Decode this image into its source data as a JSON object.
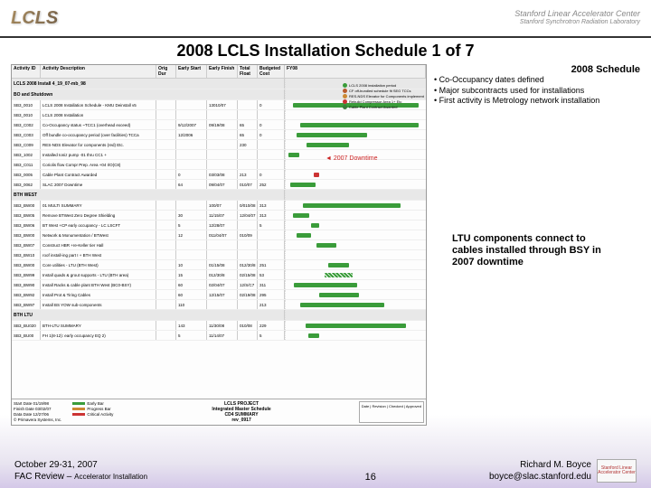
{
  "header": {
    "logo_text": "LCLS",
    "org_line1": "Stanford Linear Accelerator Center",
    "org_line2": "Stanford Synchrotron Radiation Laboratory"
  },
  "title": "2008 LCLS Installation Schedule 1 of 7",
  "chart": {
    "columns": {
      "id": "Activity ID",
      "desc": "Activity Description",
      "od": "Orig Dur",
      "es": "Early Start",
      "ef": "Early Finish",
      "tf": "Total Float",
      "bc": "Budgeted Cost",
      "fy": "FY08"
    },
    "sections": [
      {
        "label": "LCLS 2008 Install 4_19_07-mb_98",
        "rows": []
      },
      {
        "label": "BO and Shutdown",
        "rows": [
          {
            "id": "SB3_0010",
            "desc": "LCLS 2008 Installation Schedule - KMU Deinstall v5",
            "od": "",
            "es": "",
            "ef": "13010/07",
            "tf": "",
            "bc": "0"
          },
          {
            "id": "SB3_0010",
            "desc": "LCLS 2008 Installation",
            "od": "",
            "es": "",
            "ef": "",
            "tf": "",
            "bc": ""
          },
          {
            "id": "SB3_C002",
            "desc": "Co-Occupancy status ~TCC1 (overhead exceed)",
            "od": "",
            "es": "9/12/2007",
            "ef": "09/19/08",
            "tf": "65",
            "bc": "0"
          },
          {
            "id": "SB3_C003",
            "desc": "Off bundle co-occupancy period (over facilities) TCCa",
            "od": "",
            "es": "12/2006",
            "ef": "",
            "tf": "65",
            "bc": "0"
          },
          {
            "id": "SB3_C009",
            "desc": "RES-NDS Elevator for components (red)  Etc.",
            "od": "",
            "es": "",
            "ef": "",
            "tf": "230",
            "bc": ""
          },
          {
            "id": "SB3_1002",
            "desc": "Installed Ioniz pump -01 thru CC1 +",
            "od": "",
            "es": "",
            "ef": "",
            "tf": "",
            "bc": ""
          },
          {
            "id": "SB3_C011",
            "desc": "Coriolis flow Compr Prep. Area +04 I/O(C8)",
            "od": "",
            "es": "",
            "ef": "",
            "tf": "",
            "bc": ""
          },
          {
            "id": "SB3_0005",
            "desc": "Cable Plant Contract Awarded",
            "od": "",
            "es": "0",
            "ef": "03/03/08",
            "tf": "213",
            "bc": "0"
          },
          {
            "id": "SB3_0062",
            "desc": "SLAC 2007 Downtime",
            "od": "",
            "es": "64",
            "ef": "09/04/07",
            "tf": "010/07",
            "bc": "252"
          }
        ]
      },
      {
        "label": "BTH WEST",
        "rows": [
          {
            "id": "SB3_BW00",
            "desc": "01 MULTI SUMMARY",
            "od": "",
            "es": "",
            "ef": "100/07",
            "tf": "0/010/08",
            "bc": "313"
          },
          {
            "id": "SB3_BW05",
            "desc": "Remove BTWest Zero Degree Shielding",
            "od": "",
            "es": "30",
            "ef": "11/15/07",
            "tf": "12/04/07",
            "bc": "313"
          },
          {
            "id": "SB3_BW06",
            "desc": "BT West +CP early occupancy - LC LSCFT",
            "od": "",
            "es": "5",
            "ef": "12/28/07",
            "tf": "",
            "bc": "5"
          },
          {
            "id": "SB3_BW00",
            "desc": "Network & Monumentation / BTWest",
            "od": "",
            "es": "12",
            "ef": "011/04/07",
            "tf": "010/09",
            "bc": ""
          },
          {
            "id": "SB3_BW07",
            "desc": "Construct HBR +re-Keller tier Hall",
            "od": "",
            "es": "",
            "ef": "",
            "tf": "",
            "bc": ""
          },
          {
            "id": "SB3_BW10",
            "desc": "roof install-ing part I + BTH West",
            "od": "",
            "es": "",
            "ef": "",
            "tf": "",
            "bc": ""
          },
          {
            "id": "SB3_BW00",
            "desc": "Core utilities - LTU (BTH West)",
            "od": "",
            "es": "10",
            "ef": "01/15/08",
            "tf": "012/30/8",
            "bc": "251"
          },
          {
            "id": "SB3_BW99",
            "desc": "Install quads & grout supports - LTU (BTH area)",
            "od": "",
            "es": "15",
            "ef": "012/30/8",
            "tf": "02/15/08",
            "bc": "53"
          },
          {
            "id": "SB3_BW90",
            "desc": "Install Racks & cable plant BTH West (BC0-BSY)",
            "od": "",
            "es": "60",
            "ef": "02/04/07",
            "tf": "12/S/C7",
            "bc": "311"
          },
          {
            "id": "SB3_BW92",
            "desc": "Install Prot & Tiring Cables",
            "od": "",
            "es": "60",
            "ef": "12/15/07",
            "tf": "02/19/08",
            "bc": "295"
          },
          {
            "id": "SB3_BW97",
            "desc": "Install BS YOW sub-components",
            "od": "",
            "es": "110",
            "ef": "",
            "tf": "",
            "bc": "213"
          }
        ]
      },
      {
        "label": "BTH LTU",
        "rows": [
          {
            "id": "SB3_BU020",
            "desc": "BTH-LTU SUMMARY",
            "od": "",
            "es": "143",
            "ef": "11/30/08",
            "tf": "010/08",
            "bc": "229"
          },
          {
            "id": "SB3_BU00",
            "desc": "FH 1(8-12): early occupancy EQ 2)",
            "od": "",
            "es": "5",
            "ef": "11/14/07",
            "tf": "",
            "bc": "5"
          }
        ]
      }
    ],
    "right_legend": [
      {
        "color": "#3a9c3a",
        "label": "LCLS 2008 installation period"
      },
      {
        "color": "#b85c2e",
        "label": "CF off-bundled schedule fit SEG TCCs"
      },
      {
        "color": "#cc8833",
        "label": "RES-NDS Elevator for Components implement"
      },
      {
        "color": "#cc3333",
        "label": "Rebuild Compressor Area 1+ Etc"
      },
      {
        "color": "#3a7c3a",
        "label": "Cable Plant Contract Awarded"
      }
    ],
    "footer": {
      "start_date_label": "Start Date",
      "start_date": "01/19/98",
      "finish_date_label": "Finish Date",
      "finish_date": "03/02/07",
      "data_date_label": "Data Date",
      "data_date": "12/27/06",
      "legend": [
        {
          "label": "Early Bar",
          "color": "#3a9c3a"
        },
        {
          "label": "Progress Bar",
          "color": "#cc8833"
        },
        {
          "label": "Critical Activity",
          "color": "#cc3333"
        }
      ],
      "project_title": "LCLS PROJECT\nIntegrated Master Schedule\nCD4 SUMMARY\nrev_0917",
      "approval_cols": "Date | Revision | Checked | Approved",
      "copyright": "© Primavera Systems, Inc."
    }
  },
  "callout_2007": "2007 Downtime",
  "annotations": {
    "title": "2008 Schedule",
    "bullets": [
      "Co-Occupancy dates defined",
      "Major subcontracts used for installations",
      "First activity is Metrology network installation"
    ],
    "ltu": "LTU components connect to cables installed through BSY in 2007 downtime"
  },
  "footer": {
    "date": "October 29-31, 2007",
    "review": "FAC Review – ",
    "review_sub": "Accelerator Installation",
    "page": "16",
    "author": "Richard M. Boyce",
    "email": "boyce@slac.stanford.edu",
    "logo": "Stanford Linear Accelerator Center"
  }
}
